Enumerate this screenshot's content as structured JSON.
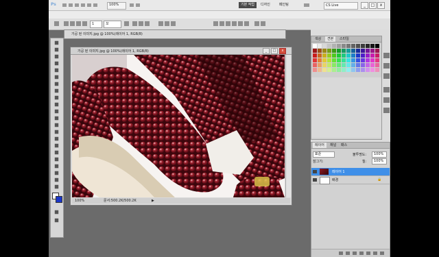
{
  "app": {
    "logo": "Ps",
    "zoom_value": "100%",
    "workspaces": [
      "기본 작업",
      "디자인",
      "페인팅"
    ],
    "active_workspace": 0,
    "cs_live_label": "CS Live",
    "window_buttons": [
      "_",
      "□",
      "x"
    ]
  },
  "options_bar": {
    "field_1": "1",
    "field_2": "꼬"
  },
  "documents": {
    "back_title": "가공 된 이미지.jpg @ 100%(레이어 1, RGB/8)",
    "front_title": "가공 된 이미지.jpg @ 100%(레이어 1, RGB/8)",
    "zoom_status": "100%",
    "doc_status": "문서:500.2K/500.2K"
  },
  "panels": {
    "swatches_tabs": [
      "색상",
      "견본",
      "스타일"
    ],
    "swatches_active": 1,
    "layers_tabs": [
      "레이어",
      "채널",
      "패스"
    ],
    "layers_active": 0,
    "blend_mode": "표준",
    "opacity_label": "불투명도:",
    "opacity_value": "100%",
    "fill_label": "칠:",
    "fill_value": "100%",
    "lock_label": "잠그기:",
    "layers": [
      {
        "name": "레이어 1",
        "selected": true
      },
      {
        "name": "배경",
        "selected": false
      }
    ]
  },
  "colors": {
    "app_bg": "#6b6b6b",
    "selection": "#3f8fe8",
    "close_button": "#d34d3a"
  }
}
